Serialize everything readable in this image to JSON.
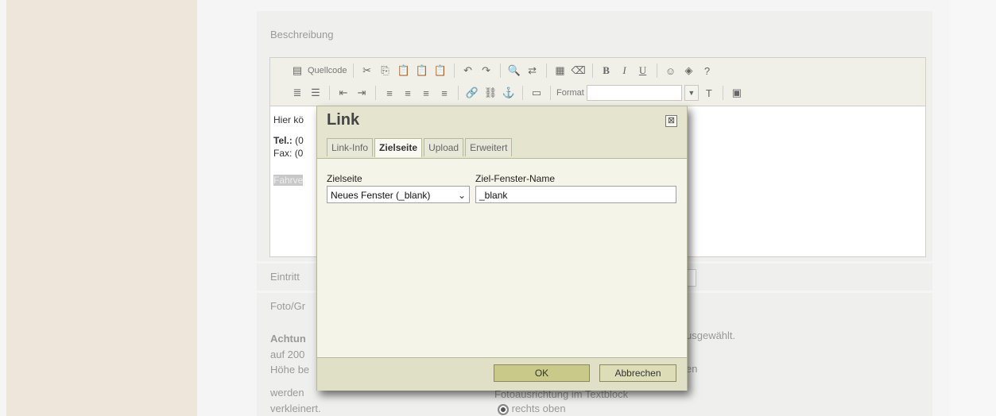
{
  "form": {
    "beschreibung_label": "Beschreibung",
    "eintritt_label": "Eintritt",
    "foto_label": "Foto/Gr",
    "achtung_text": "Achtun",
    "auf200_text": "auf 200",
    "hoehe_text": "Höhe be",
    "werden_text": "werden",
    "verkleinert_text": "verkleinert.",
    "ausgewaehlt_text": "usgewählt.",
    "en_text": "en",
    "fotoausrichtung_text": "Fotoausrichtung im Textblock",
    "radio_label": "rechts oben"
  },
  "toolbar": {
    "source_label": "Quellcode",
    "format_label": "Format"
  },
  "editor": {
    "line1": "Hier kö",
    "tel_label": "Tel.:",
    "tel_value": "(0",
    "fax_label": "Fax:",
    "fax_value": "(0",
    "selected_text": "Fahrve"
  },
  "dialog": {
    "title": "Link",
    "close_symbol": "⊠",
    "tabs": [
      {
        "label": "Link-Info",
        "active": false
      },
      {
        "label": "Zielseite",
        "active": true
      },
      {
        "label": "Upload",
        "active": false
      },
      {
        "label": "Erweitert",
        "active": false
      }
    ],
    "target_label": "Zielseite",
    "target_value": "Neues Fenster (_blank)",
    "window_name_label": "Ziel-Fenster-Name",
    "window_name_value": "_blank",
    "ok_label": "OK",
    "cancel_label": "Abbrechen"
  }
}
